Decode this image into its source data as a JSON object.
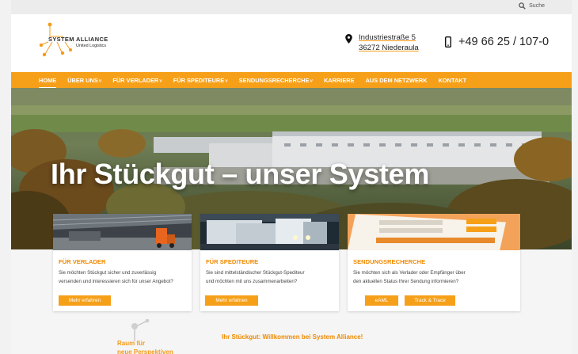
{
  "topbar": {
    "search_label": "Suche"
  },
  "header": {
    "logo_name": "SYSTEM ALLIANCE",
    "logo_sub": "United Logistics",
    "address_line1": "Industriestraße 5",
    "address_line2": "36272 Niederaula",
    "phone": "+49 66 25 / 107-0"
  },
  "nav": {
    "items": [
      {
        "label": "HOME",
        "caret": ""
      },
      {
        "label": "ÜBER UNS",
        "caret": "˅"
      },
      {
        "label": "FÜR VERLADER",
        "caret": "˅"
      },
      {
        "label": "FÜR SPEDITEURE",
        "caret": "˅"
      },
      {
        "label": "SENDUNGSRECHERCHE",
        "caret": "˅"
      },
      {
        "label": "KARRIERE",
        "caret": ""
      },
      {
        "label": "AUS DEM NETZWERK",
        "caret": ""
      },
      {
        "label": "KONTAKT",
        "caret": ""
      }
    ]
  },
  "hero": {
    "title": "Ihr Stückgut – unser System"
  },
  "cards": [
    {
      "title": "FÜR VERLADER",
      "text_line1": "Sie möchten Stückgut sicher und zuverlässig",
      "text_line2": "versenden und interessieren sich für unser Angebot?",
      "button": "Mehr erfahren"
    },
    {
      "title": "FÜR SPEDITEURE",
      "text_line1": "Sie sind mittelständischer Stückgut-Spediteur",
      "text_line2": "und möchten mit uns zusammenarbeiten?",
      "button": "Mehr erfahren"
    },
    {
      "title": "SENDUNGSRECHERCHE",
      "text_line1": "Sie möchten sich als Verlader oder Empfänger über",
      "text_line2": "den aktuellen Status Ihrer Sendung informieren?",
      "button_a": "eAML",
      "button_b": "Track & Trace"
    }
  ],
  "bottom": {
    "raum_line1": "Raum für",
    "raum_line2": "neue Perspektiven",
    "welcome": "Ihr Stückgut: Willkommen bei System Alliance!"
  },
  "colors": {
    "accent": "#f6a01a",
    "accent_text": "#f08a00"
  }
}
